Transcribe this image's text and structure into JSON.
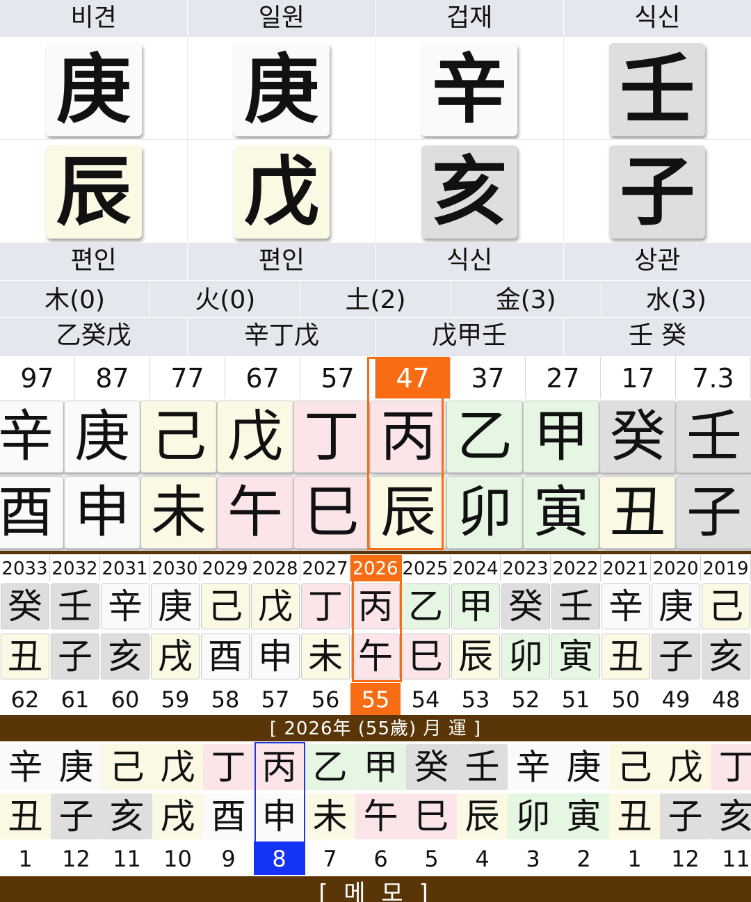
{
  "pillars": {
    "top_labels": [
      "비견",
      "일원",
      "겁재",
      "식신"
    ],
    "stems": [
      {
        "char": "庚",
        "color": "w"
      },
      {
        "char": "庚",
        "color": "w"
      },
      {
        "char": "辛",
        "color": "w"
      },
      {
        "char": "壬",
        "color": "g"
      }
    ],
    "branches": [
      {
        "char": "辰",
        "color": "y"
      },
      {
        "char": "戊",
        "color": "y"
      },
      {
        "char": "亥",
        "color": "g"
      },
      {
        "char": "子",
        "color": "g"
      }
    ],
    "bottom_labels": [
      "편인",
      "편인",
      "식신",
      "상관"
    ],
    "hidden_stems": [
      "乙癸戊",
      "辛丁戊",
      "戊甲壬",
      "壬 癸"
    ]
  },
  "five_elements": [
    "木(0)",
    "火(0)",
    "土(2)",
    "金(3)",
    "水(3)"
  ],
  "great_luck": {
    "ages": [
      "97",
      "87",
      "77",
      "67",
      "57",
      "47",
      "37",
      "27",
      "17",
      "7.3"
    ],
    "selected_index": 5,
    "stems": [
      {
        "char": "辛",
        "color": "w"
      },
      {
        "char": "庚",
        "color": "w"
      },
      {
        "char": "己",
        "color": "y"
      },
      {
        "char": "戊",
        "color": "y"
      },
      {
        "char": "丁",
        "color": "p"
      },
      {
        "char": "丙",
        "color": "p"
      },
      {
        "char": "乙",
        "color": "gr"
      },
      {
        "char": "甲",
        "color": "gr"
      },
      {
        "char": "癸",
        "color": "g"
      },
      {
        "char": "壬",
        "color": "g"
      }
    ],
    "branches": [
      {
        "char": "酉",
        "color": "w"
      },
      {
        "char": "申",
        "color": "w"
      },
      {
        "char": "未",
        "color": "y"
      },
      {
        "char": "午",
        "color": "p"
      },
      {
        "char": "巳",
        "color": "p"
      },
      {
        "char": "辰",
        "color": "y"
      },
      {
        "char": "卯",
        "color": "gr"
      },
      {
        "char": "寅",
        "color": "gr"
      },
      {
        "char": "丑",
        "color": "y"
      },
      {
        "char": "子",
        "color": "g"
      }
    ]
  },
  "yearly_luck": {
    "years": [
      "2033",
      "2032",
      "2031",
      "2030",
      "2029",
      "2028",
      "2027",
      "2026",
      "2025",
      "2024",
      "2023",
      "2022",
      "2021",
      "2020",
      "2019"
    ],
    "selected_index": 7,
    "stems": [
      {
        "char": "癸",
        "color": "g"
      },
      {
        "char": "壬",
        "color": "g"
      },
      {
        "char": "辛",
        "color": "w"
      },
      {
        "char": "庚",
        "color": "w"
      },
      {
        "char": "己",
        "color": "y"
      },
      {
        "char": "戊",
        "color": "y"
      },
      {
        "char": "丁",
        "color": "p"
      },
      {
        "char": "丙",
        "color": "p"
      },
      {
        "char": "乙",
        "color": "gr"
      },
      {
        "char": "甲",
        "color": "gr"
      },
      {
        "char": "癸",
        "color": "g"
      },
      {
        "char": "壬",
        "color": "g"
      },
      {
        "char": "辛",
        "color": "w"
      },
      {
        "char": "庚",
        "color": "w"
      },
      {
        "char": "己",
        "color": "y"
      }
    ],
    "branches": [
      {
        "char": "丑",
        "color": "y"
      },
      {
        "char": "子",
        "color": "g"
      },
      {
        "char": "亥",
        "color": "g"
      },
      {
        "char": "戌",
        "color": "y"
      },
      {
        "char": "酉",
        "color": "w"
      },
      {
        "char": "申",
        "color": "w"
      },
      {
        "char": "未",
        "color": "y"
      },
      {
        "char": "午",
        "color": "p"
      },
      {
        "char": "巳",
        "color": "p"
      },
      {
        "char": "辰",
        "color": "y"
      },
      {
        "char": "卯",
        "color": "gr"
      },
      {
        "char": "寅",
        "color": "gr"
      },
      {
        "char": "丑",
        "color": "y"
      },
      {
        "char": "子",
        "color": "g"
      },
      {
        "char": "亥",
        "color": "g"
      }
    ],
    "ages": [
      "62",
      "61",
      "60",
      "59",
      "58",
      "57",
      "56",
      "55",
      "54",
      "53",
      "52",
      "51",
      "50",
      "49",
      "48"
    ]
  },
  "monthly_luck": {
    "title": "[ 2026年 (55歲) 月 運 ]",
    "selected_index": 5,
    "stems": [
      {
        "char": "辛",
        "color": "w"
      },
      {
        "char": "庚",
        "color": "w"
      },
      {
        "char": "己",
        "color": "y"
      },
      {
        "char": "戊",
        "color": "y"
      },
      {
        "char": "丁",
        "color": "p"
      },
      {
        "char": "丙",
        "color": "p"
      },
      {
        "char": "乙",
        "color": "gr"
      },
      {
        "char": "甲",
        "color": "gr"
      },
      {
        "char": "癸",
        "color": "g"
      },
      {
        "char": "壬",
        "color": "g"
      },
      {
        "char": "辛",
        "color": "w"
      },
      {
        "char": "庚",
        "color": "w"
      },
      {
        "char": "己",
        "color": "y"
      },
      {
        "char": "戊",
        "color": "y"
      },
      {
        "char": "丁",
        "color": "p"
      }
    ],
    "branches": [
      {
        "char": "丑",
        "color": "y"
      },
      {
        "char": "子",
        "color": "g"
      },
      {
        "char": "亥",
        "color": "g"
      },
      {
        "char": "戌",
        "color": "y"
      },
      {
        "char": "酉",
        "color": "w"
      },
      {
        "char": "申",
        "color": "w"
      },
      {
        "char": "未",
        "color": "y"
      },
      {
        "char": "午",
        "color": "p"
      },
      {
        "char": "巳",
        "color": "p"
      },
      {
        "char": "辰",
        "color": "y"
      },
      {
        "char": "卯",
        "color": "gr"
      },
      {
        "char": "寅",
        "color": "gr"
      },
      {
        "char": "丑",
        "color": "y"
      },
      {
        "char": "子",
        "color": "g"
      },
      {
        "char": "亥",
        "color": "g"
      }
    ],
    "months": [
      "1",
      "12",
      "11",
      "10",
      "9",
      "8",
      "7",
      "6",
      "5",
      "4",
      "3",
      "2",
      "1",
      "12",
      "11"
    ]
  },
  "memo_label": "[ 메 모 ]",
  "colors": {
    "accent_orange": "#f86d14",
    "month_select_blue": "#1533f5",
    "brown_bar": "#5a3507"
  }
}
